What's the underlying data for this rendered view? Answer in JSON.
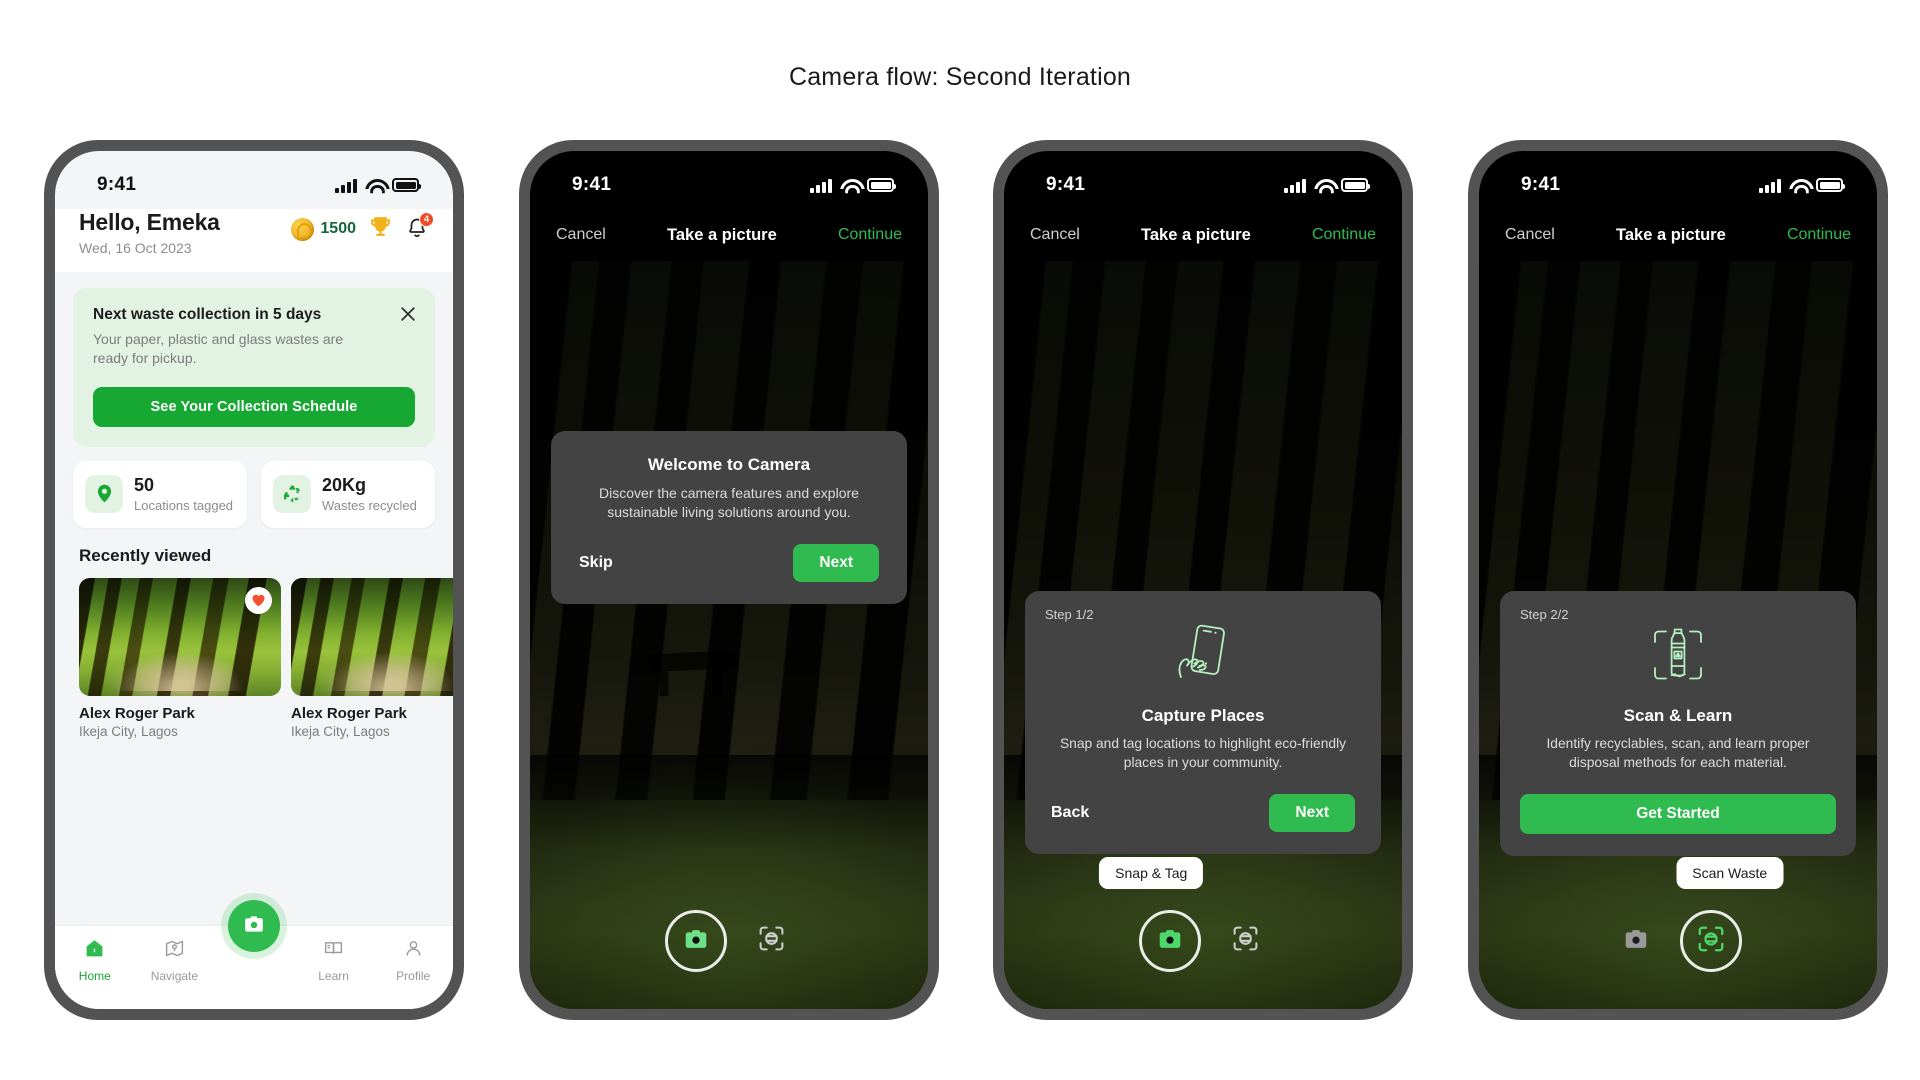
{
  "page": {
    "title": "Camera flow: Second Iteration"
  },
  "status_bar": {
    "time": "9:41",
    "signal_icon": "cellular-signal-icon",
    "wifi_icon": "wifi-icon",
    "battery_icon": "battery-icon"
  },
  "home": {
    "greeting": "Hello, Emeka",
    "date": "Wed, 16 Oct 2023",
    "coins": "1500",
    "trophy_icon": "trophy-icon",
    "bell_icon": "bell-icon",
    "notification_count": "4",
    "banner": {
      "title": "Next waste collection in 5 days",
      "subtitle": "Your paper, plastic and glass wastes are ready for pickup.",
      "cta": "See Your Collection Schedule",
      "close_icon": "close-icon"
    },
    "stats": [
      {
        "value": "50",
        "label": "Locations tagged",
        "icon": "location-pin-icon"
      },
      {
        "value": "20Kg",
        "label": "Wastes recycled",
        "icon": "recycle-icon"
      }
    ],
    "section_title": "Recently viewed",
    "places": [
      {
        "name": "Alex Roger Park",
        "location": "Ikeja City, Lagos",
        "favorited": true
      },
      {
        "name": "Alex Roger Park",
        "location": "Ikeja City, Lagos",
        "favorited": false
      }
    ],
    "tabs": [
      {
        "label": "Home",
        "icon": "home-icon",
        "active": true
      },
      {
        "label": "Navigate",
        "icon": "navigate-icon",
        "active": false
      },
      {
        "label": "Learn",
        "icon": "book-icon",
        "active": false
      },
      {
        "label": "Profile",
        "icon": "person-icon",
        "active": false
      }
    ],
    "fab_icon": "camera-icon"
  },
  "camera_nav": {
    "cancel": "Cancel",
    "title": "Take a picture",
    "continue": "Continue"
  },
  "screen2": {
    "modal": {
      "title": "Welcome to Camera",
      "subtitle": "Discover the camera features and explore sustainable living solutions around you.",
      "skip": "Skip",
      "next": "Next"
    },
    "controls": {
      "shutter_icon": "camera-icon",
      "scan_icon": "scan-waste-icon"
    }
  },
  "screen3": {
    "card": {
      "step": "Step 1/2",
      "icon": "hand-holding-phone-icon",
      "title": "Capture Places",
      "subtitle": "Snap and tag locations to highlight eco-friendly places in your community.",
      "back": "Back",
      "next": "Next"
    },
    "tooltip": "Snap & Tag",
    "controls": {
      "shutter_icon": "camera-icon",
      "scan_icon": "scan-waste-icon"
    }
  },
  "screen4": {
    "card": {
      "step": "Step 2/2",
      "icon": "scan-bottle-icon",
      "title": "Scan & Learn",
      "subtitle": "Identify recyclables, scan, and learn proper disposal methods for each material.",
      "cta": "Get Started"
    },
    "tooltip": "Scan Waste",
    "controls": {
      "shutter_icon": "camera-icon",
      "scan_icon": "scan-waste-icon"
    }
  },
  "colors": {
    "brand_green": "#17a833",
    "accent_green": "#2fbb4f",
    "badge_red": "#f04b24",
    "coin_gold": "#f0b429"
  }
}
